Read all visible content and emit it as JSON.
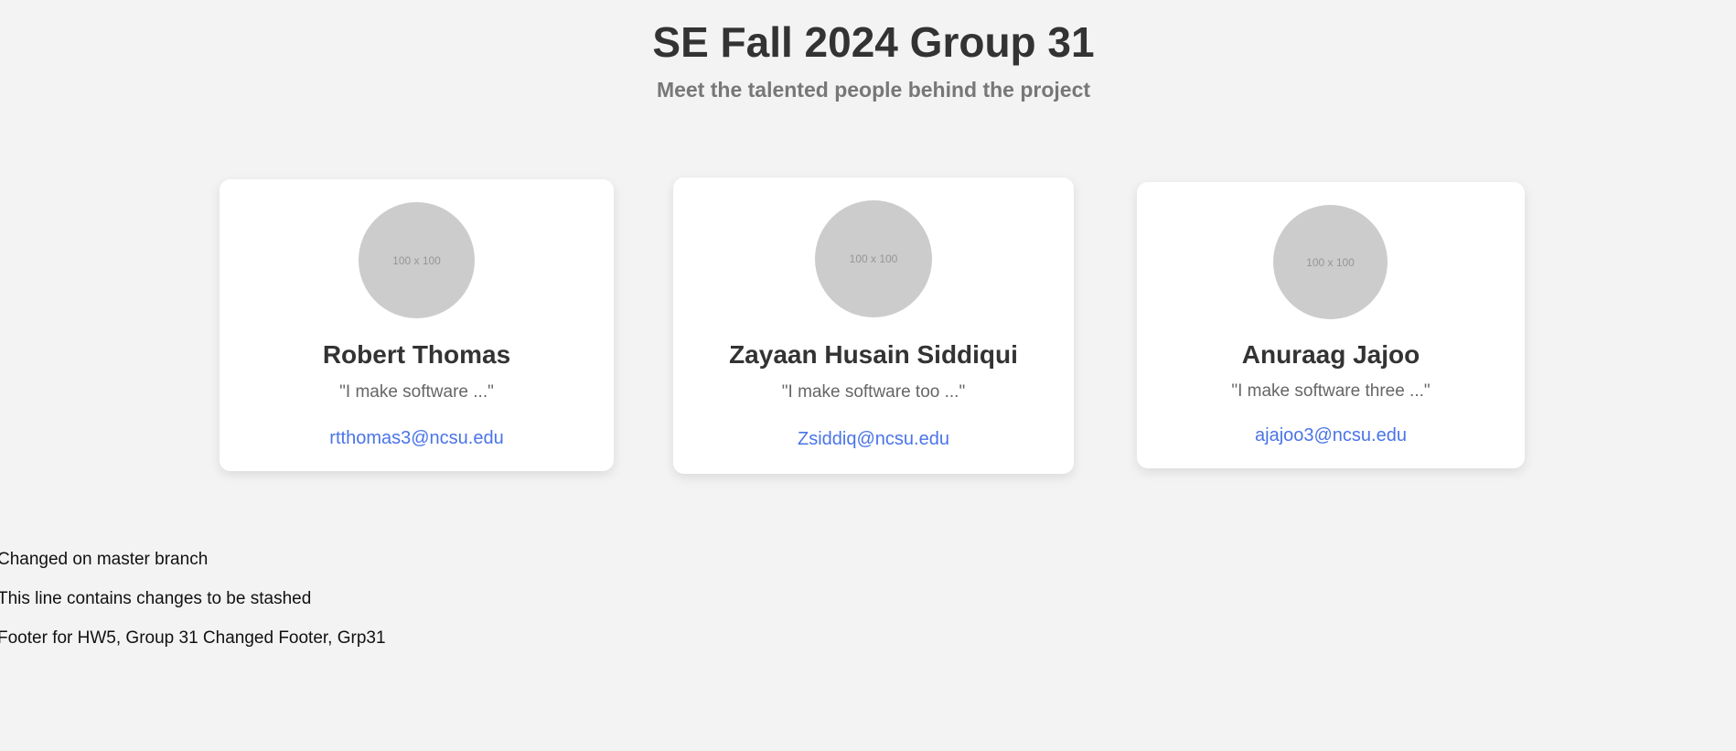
{
  "header": {
    "title": "SE Fall 2024 Group 31",
    "subtitle": "Meet the talented people behind the project"
  },
  "team": [
    {
      "avatar_text": "100 x 100",
      "name": "Robert Thomas",
      "quote": "\"I make software ...\"",
      "email": "rtthomas3@ncsu.edu"
    },
    {
      "avatar_text": "100 x 100",
      "name": "Zayaan Husain Siddiqui",
      "quote": "\"I make software too ...\"",
      "email": "Zsiddiq@ncsu.edu"
    },
    {
      "avatar_text": "100 x 100",
      "name": "Anuraag Jajoo",
      "quote": "\"I make software three ...\"",
      "email": "ajajoo3@ncsu.edu"
    }
  ],
  "notes": [
    "Changed on master branch",
    "This line contains changes to be stashed",
    "Footer for HW5, Group 31 Changed Footer, Grp31"
  ],
  "colors": {
    "background": "#f3f3f3",
    "card": "#ffffff",
    "avatar_placeholder": "#cccccc",
    "link": "#4a74e8",
    "title": "#333333",
    "subtitle": "#777777"
  }
}
